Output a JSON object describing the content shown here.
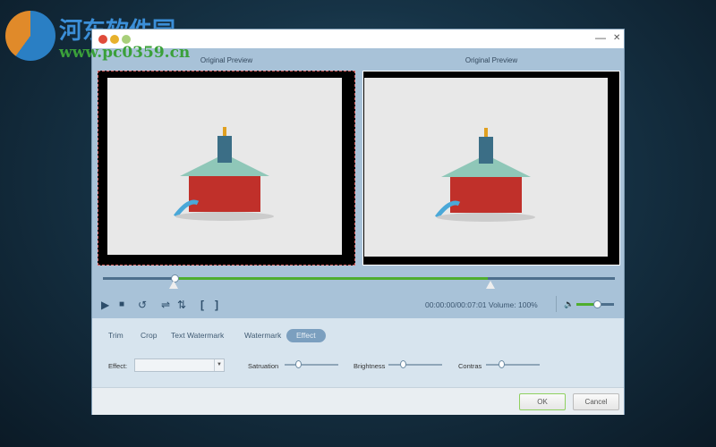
{
  "watermark": {
    "title": "河东软件园",
    "url": "www.pc0359.cn"
  },
  "window": {
    "minimize": "—",
    "close": "✕"
  },
  "preview": {
    "left_label": "Original Preview",
    "right_label": "Original Preview"
  },
  "timeline": {
    "position_fraction": 0.14,
    "end_marker_fraction": 0.76
  },
  "controls": {
    "play": "▶",
    "stop": "■",
    "undo": "↺",
    "swap_h": "⇌",
    "swap_v": "⇅",
    "mark_in": "[",
    "mark_out": "]",
    "time": "00:00:00/00:07:01",
    "volume_label": "Volume:  100%",
    "volume": 100
  },
  "tabs": [
    {
      "label": "Trim"
    },
    {
      "label": "Crop"
    },
    {
      "label": "Text Watermark"
    },
    {
      "label": "Watermark"
    },
    {
      "label": "Effect",
      "active": true
    }
  ],
  "effect": {
    "label": "Effect:",
    "value": "",
    "saturation_label": "Satruation",
    "brightness_label": "Brightness",
    "contrast_label": "Contras"
  },
  "footer": {
    "ok": "OK",
    "cancel": "Cancel"
  },
  "colors": {
    "accent": "#4fae2d",
    "panel": "#a8c2d8",
    "active_tab": "#7b9fbf"
  }
}
